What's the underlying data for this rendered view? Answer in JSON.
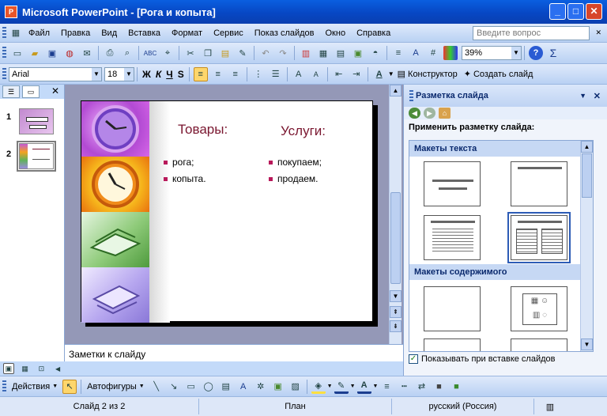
{
  "window": {
    "title": "Microsoft PowerPoint - [Рога и копыта]",
    "app_icon": "P",
    "min": "_",
    "max": "□",
    "close": "✕"
  },
  "menu": {
    "items": [
      "Файл",
      "Правка",
      "Вид",
      "Вставка",
      "Формат",
      "Сервис",
      "Показ слайдов",
      "Окно",
      "Справка"
    ],
    "question_placeholder": "Введите вопрос",
    "close_doc": "✕"
  },
  "toolbar": {
    "zoom": "39%",
    "help": "?"
  },
  "format_toolbar": {
    "font": "Arial",
    "size": "18",
    "bold": "Ж",
    "italic": "К",
    "underline": "Ч",
    "shadow": "S",
    "designer": "Конструктор",
    "new_slide": "Создать слайд"
  },
  "slides_pane": {
    "num1": "1",
    "num2": "2"
  },
  "slide": {
    "heading_left": "Товары:",
    "heading_right": "Услуги:",
    "left_bullets": [
      "рога;",
      "копыта."
    ],
    "right_bullets": [
      "покупаем;",
      "продаем."
    ]
  },
  "notes": {
    "placeholder": "Заметки к слайду"
  },
  "task_pane": {
    "title": "Разметка слайда",
    "apply_label": "Применить разметку слайда:",
    "section_text": "Макеты текста",
    "section_content": "Макеты содержимого",
    "checkbox_label": "Показывать при вставке слайдов",
    "checkbox_checked": true
  },
  "draw_toolbar": {
    "actions": "Действия",
    "autoshapes": "Автофигуры"
  },
  "status": {
    "slide": "Слайд 2 из 2",
    "design": "План",
    "language": "русский (Россия)"
  },
  "colors": {
    "title_gradient": "#0747c4",
    "slide_heading": "#7a1730",
    "bullet": "#b8195a",
    "workspace": "#9498b7"
  }
}
